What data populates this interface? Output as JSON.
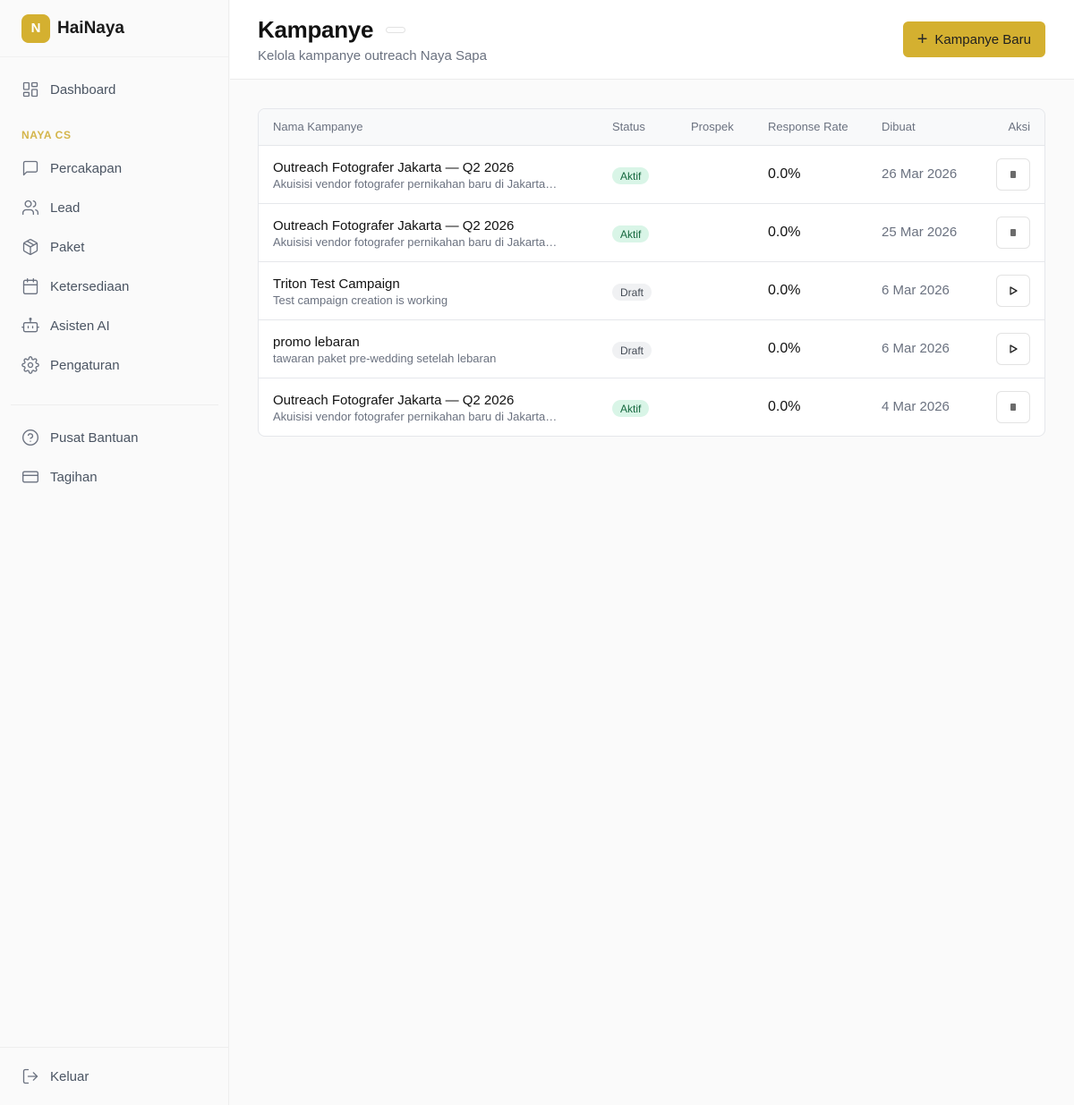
{
  "brand": {
    "logo_letter": "N",
    "name": "HaiNaya"
  },
  "sidebar": {
    "dashboard": {
      "label": "Dashboard",
      "icon": "layout-dashboard-icon"
    },
    "section_label": "NAYA CS",
    "items": [
      {
        "label": "Percakapan",
        "icon": "message-square-icon"
      },
      {
        "label": "Lead",
        "icon": "users-icon"
      },
      {
        "label": "Paket",
        "icon": "package-icon"
      },
      {
        "label": "Ketersediaan",
        "icon": "calendar-icon"
      },
      {
        "label": "Asisten AI",
        "icon": "bot-icon"
      },
      {
        "label": "Pengaturan",
        "icon": "settings-icon"
      }
    ],
    "secondary": [
      {
        "label": "Pusat Bantuan",
        "icon": "help-circle-icon"
      },
      {
        "label": "Tagihan",
        "icon": "credit-card-icon"
      }
    ],
    "logout": {
      "label": "Keluar",
      "icon": "log-out-icon"
    }
  },
  "header": {
    "title": "Kampanye",
    "subtitle": "Kelola kampanye outreach Naya Sapa",
    "new_button": "Kampanye Baru"
  },
  "table": {
    "columns": [
      "Nama Kampanye",
      "Status",
      "Prospek",
      "Response Rate",
      "Dibuat",
      "Aksi"
    ],
    "rows": [
      {
        "name": "Outreach Fotografer Jakarta — Q2 2026",
        "desc": "Akuisisi vendor fotografer pernikahan baru di Jakarta da...",
        "status": "Aktif",
        "prospek": "",
        "rate": "0.0%",
        "date": "26 Mar 2026",
        "action": "stop"
      },
      {
        "name": "Outreach Fotografer Jakarta — Q2 2026",
        "desc": "Akuisisi vendor fotografer pernikahan baru di Jakarta da...",
        "status": "Aktif",
        "prospek": "",
        "rate": "0.0%",
        "date": "25 Mar 2026",
        "action": "stop"
      },
      {
        "name": "Triton Test Campaign",
        "desc": "Test campaign creation is working",
        "status": "Draft",
        "prospek": "",
        "rate": "0.0%",
        "date": "6 Mar 2026",
        "action": "play"
      },
      {
        "name": "promo lebaran",
        "desc": "tawaran paket pre-wedding setelah lebaran",
        "status": "Draft",
        "prospek": "",
        "rate": "0.0%",
        "date": "6 Mar 2026",
        "action": "play"
      },
      {
        "name": "Outreach Fotografer Jakarta — Q2 2026",
        "desc": "Akuisisi vendor fotografer pernikahan baru di Jakarta da...",
        "status": "Aktif",
        "prospek": "",
        "rate": "0.0%",
        "date": "4 Mar 2026",
        "action": "stop"
      }
    ]
  },
  "colors": {
    "accent": "#d4b030",
    "section_label": "#d4b54a",
    "active_badge_bg": "#d9f5e7",
    "active_badge_text": "#16683f"
  }
}
